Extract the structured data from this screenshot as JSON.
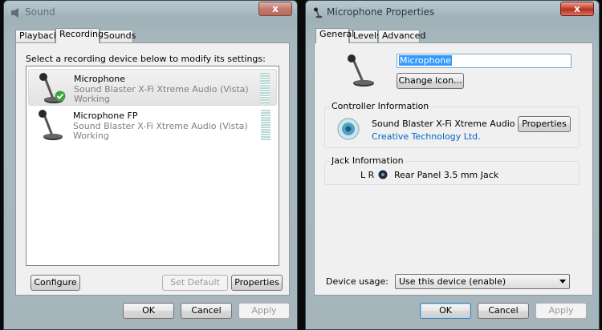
{
  "sound_window": {
    "title": "Sound",
    "close": "x",
    "tabs": [
      "Playback",
      "Recording",
      "Sounds"
    ],
    "instruction": "Select a recording device below to modify its settings:",
    "devices": [
      {
        "name": "Microphone",
        "device": "Sound Blaster X-Fi Xtreme Audio (Vista)",
        "status": "Working",
        "selected": true
      },
      {
        "name": "Microphone FP",
        "device": "Sound Blaster X-Fi Xtreme Audio (Vista)",
        "status": "Working",
        "selected": false
      }
    ],
    "buttons": {
      "configure": "Configure",
      "set_default": "Set Default",
      "properties": "Properties",
      "ok": "OK",
      "cancel": "Cancel",
      "apply": "Apply"
    }
  },
  "mic_properties": {
    "title": "Microphone Properties",
    "close": "x",
    "tabs": [
      "General",
      "Levels",
      "Advanced"
    ],
    "name_value": "Microphone",
    "change_icon": "Change Icon...",
    "controller_label": "Controller Information",
    "controller_name": "Sound Blaster X-Fi Xtreme Audio",
    "controller_vendor": "Creative Technology Ltd.",
    "controller_properties": "Properties",
    "jack_label": "Jack Information",
    "jack_channels": "L R",
    "jack_name": "Rear Panel 3.5 mm Jack",
    "device_usage_label": "Device usage:",
    "device_usage_value": "Use this device (enable)",
    "buttons": {
      "ok": "OK",
      "cancel": "Cancel",
      "apply": "Apply"
    }
  },
  "colors": {
    "accent": "#3399ff",
    "link": "#0066cc",
    "close_red": "#c8452f",
    "check_green": "#3aa53a"
  }
}
